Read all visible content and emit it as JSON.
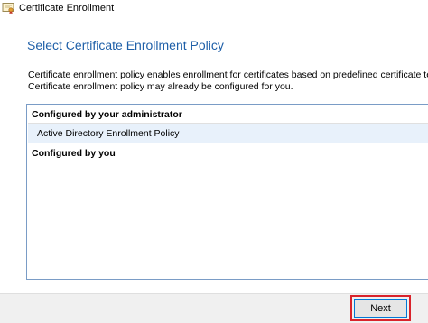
{
  "window": {
    "title": "Certificate Enrollment",
    "icon": "certificate-icon"
  },
  "page": {
    "heading": "Select Certificate Enrollment Policy",
    "description_lines": [
      "Certificate enrollment policy enables enrollment for certificates based on predefined certificate te",
      "Certificate enrollment policy may already be configured for you."
    ]
  },
  "policy_list": {
    "groups": [
      {
        "header": "Configured by your administrator",
        "items": [
          "Active Directory Enrollment Policy"
        ]
      },
      {
        "header": "Configured by you",
        "items": []
      }
    ]
  },
  "footer": {
    "next_label": "Next",
    "highlight_color": "#d9232b"
  }
}
